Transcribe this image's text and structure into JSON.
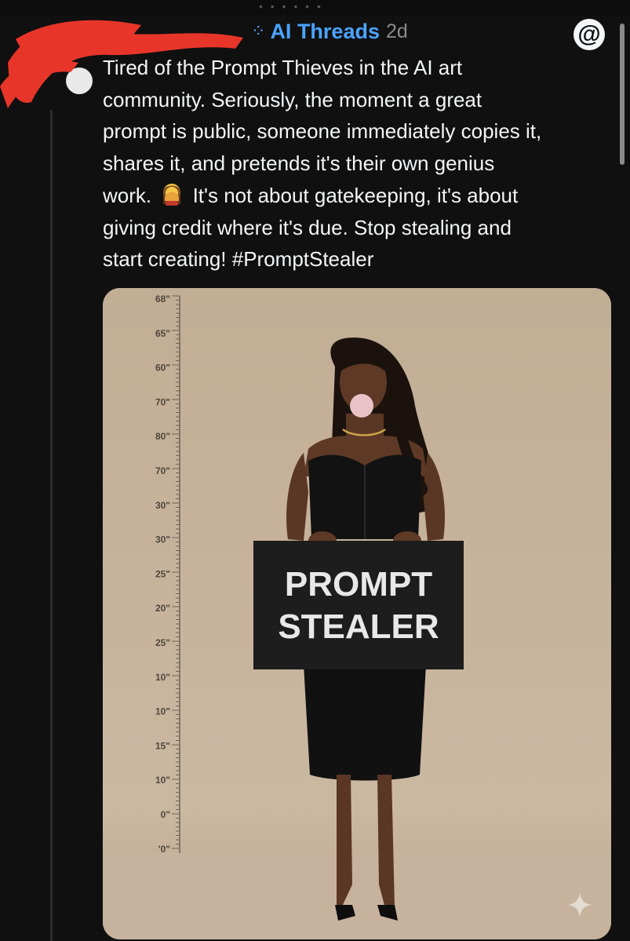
{
  "header": {
    "community_name": "AI Threads",
    "community_icon": "threads-community-icon",
    "timestamp": "2d"
  },
  "post": {
    "text_line1": "Tired of the Prompt Thieves in the AI art",
    "text_line2": "community. Seriously, the moment a great",
    "text_line3": "prompt is public, someone immediately copies it,",
    "text_line4": "shares it, and pretends it's their own genius",
    "text_line5_a": "work. ",
    "emoji": "facepalm-emoji",
    "text_line5_b": " It's not about gatekeeping, it's about",
    "text_line6": "giving credit where it's due. Stop stealing and",
    "text_line7": "start creating! #PromptStealer"
  },
  "image": {
    "sign_line1": "PROMPT",
    "sign_line2": "STEALER",
    "height_marks": [
      "68\"",
      "65\"",
      "60\"",
      "70\"",
      "80\"",
      "70\"",
      "30\"",
      "30\"",
      "25\"",
      "20\"",
      "25\"",
      "10\"",
      "10\"",
      "15\"",
      "10\"",
      "0\"",
      "'0\""
    ]
  },
  "colors": {
    "background": "#101010",
    "text": "#f3f5f7",
    "accent": "#4aa3ff",
    "muted": "#8a8a8a",
    "photo_backdrop": "#c6b29b",
    "redaction": "#e8352a"
  }
}
